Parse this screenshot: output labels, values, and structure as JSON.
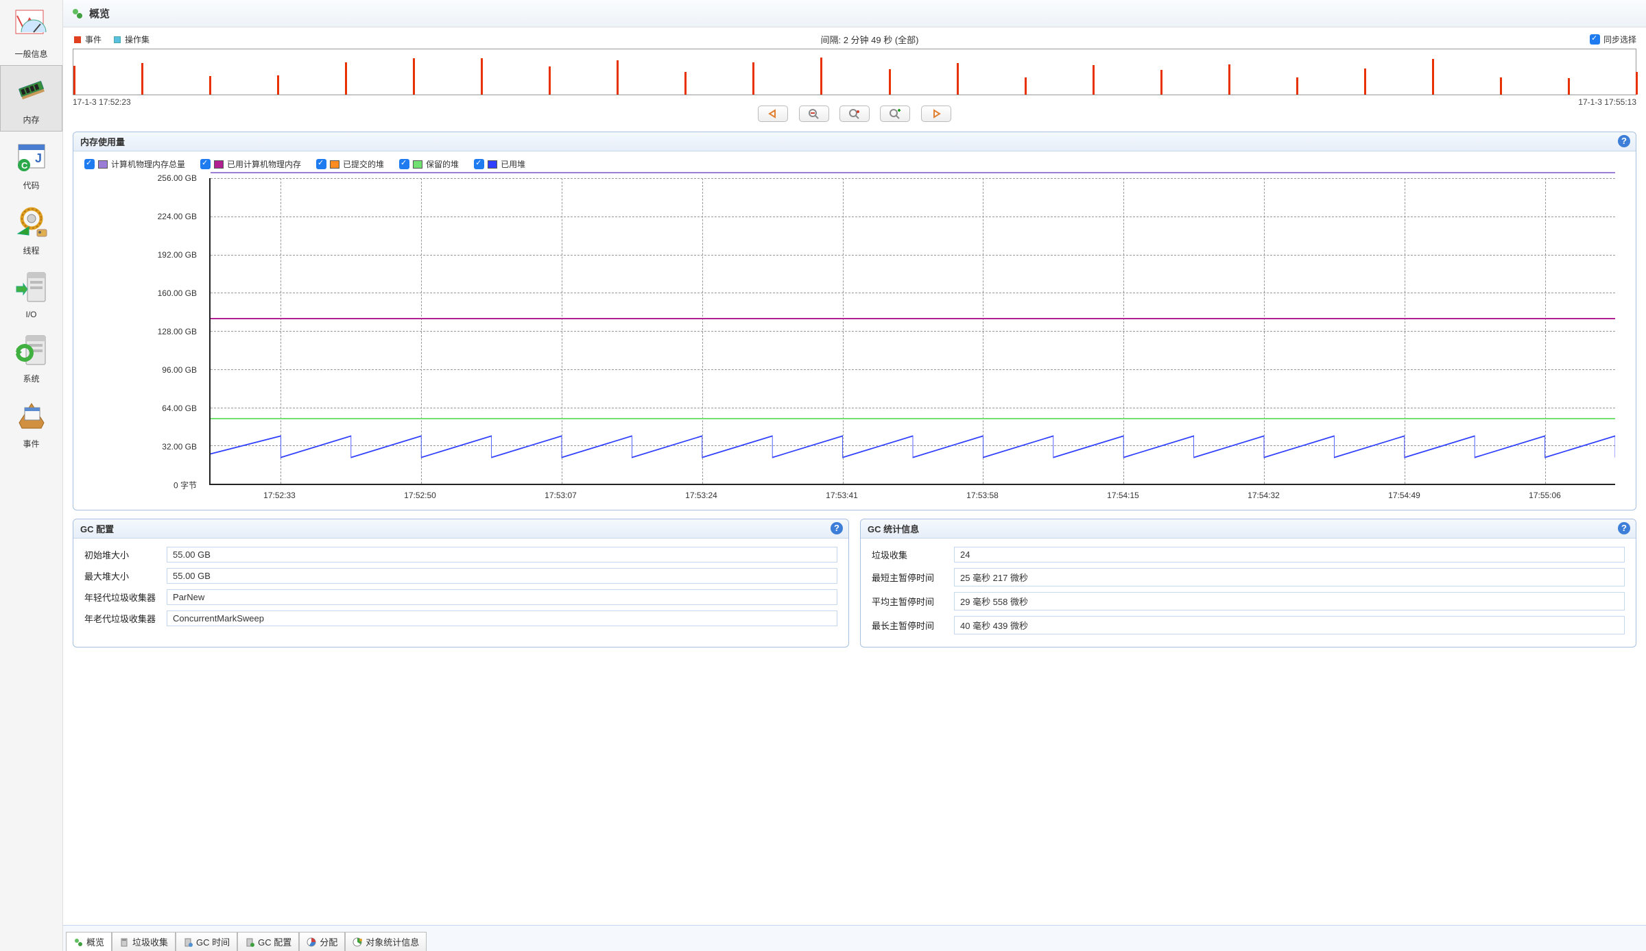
{
  "sidebar": {
    "items": [
      {
        "label": "一般信息"
      },
      {
        "label": "内存"
      },
      {
        "label": "代码"
      },
      {
        "label": "线程"
      },
      {
        "label": "I/O"
      },
      {
        "label": "系统"
      },
      {
        "label": "事件"
      }
    ]
  },
  "title": "概览",
  "legend": {
    "events": "事件",
    "opset": "操作集"
  },
  "interval": "间隔: 2 分钟 49 秒 (全部)",
  "sync_label": "同步选择",
  "time_start": "17-1-3 17:52:23",
  "time_end": "17-1-3 17:55:13",
  "mem_panel": {
    "title": "内存使用量",
    "series": [
      {
        "label": "计算机物理内存总量",
        "color": "#9b7dd8"
      },
      {
        "label": "已用计算机物理内存",
        "color": "#b02090"
      },
      {
        "label": "已提交的堆",
        "color": "#ff8c20"
      },
      {
        "label": "保留的堆",
        "color": "#70e070"
      },
      {
        "label": "已用堆",
        "color": "#3040ff"
      }
    ]
  },
  "chart_data": {
    "type": "line",
    "ylabel": "",
    "xlabel": "",
    "y_ticks": [
      "256.00 GB",
      "224.00 GB",
      "192.00 GB",
      "160.00 GB",
      "128.00 GB",
      "96.00 GB",
      "64.00 GB",
      "32.00 GB",
      "0 字节"
    ],
    "x_ticks": [
      "17:52:33",
      "17:52:50",
      "17:53:07",
      "17:53:24",
      "17:53:41",
      "17:53:58",
      "17:54:15",
      "17:54:32",
      "17:54:49",
      "17:55:06"
    ],
    "y_range": [
      0,
      256
    ],
    "flat_series": {
      "physical_total": 261,
      "physical_used": 139,
      "committed_heap": 55,
      "reserved_heap": 55
    },
    "used_heap_range": [
      20,
      40
    ],
    "used_heap_cycles": 20
  },
  "gc_config": {
    "title": "GC 配置",
    "rows": [
      {
        "label": "初始堆大小",
        "value": "55.00 GB"
      },
      {
        "label": "最大堆大小",
        "value": "55.00 GB"
      },
      {
        "label": "年轻代垃圾收集器",
        "value": "ParNew"
      },
      {
        "label": "年老代垃圾收集器",
        "value": "ConcurrentMarkSweep"
      }
    ]
  },
  "gc_stats": {
    "title": "GC 统计信息",
    "rows": [
      {
        "label": "垃圾收集",
        "value": "24"
      },
      {
        "label": "最短主暂停时间",
        "value": "25 毫秒 217 微秒"
      },
      {
        "label": "平均主暂停时间",
        "value": "29 毫秒 558 微秒"
      },
      {
        "label": "最长主暂停时间",
        "value": "40 毫秒 439 微秒"
      }
    ]
  },
  "tabs": [
    {
      "label": "概览"
    },
    {
      "label": "垃圾收集"
    },
    {
      "label": "GC 时间"
    },
    {
      "label": "GC 配置"
    },
    {
      "label": "分配"
    },
    {
      "label": "对象统计信息"
    }
  ],
  "timeline_ticks": 24
}
